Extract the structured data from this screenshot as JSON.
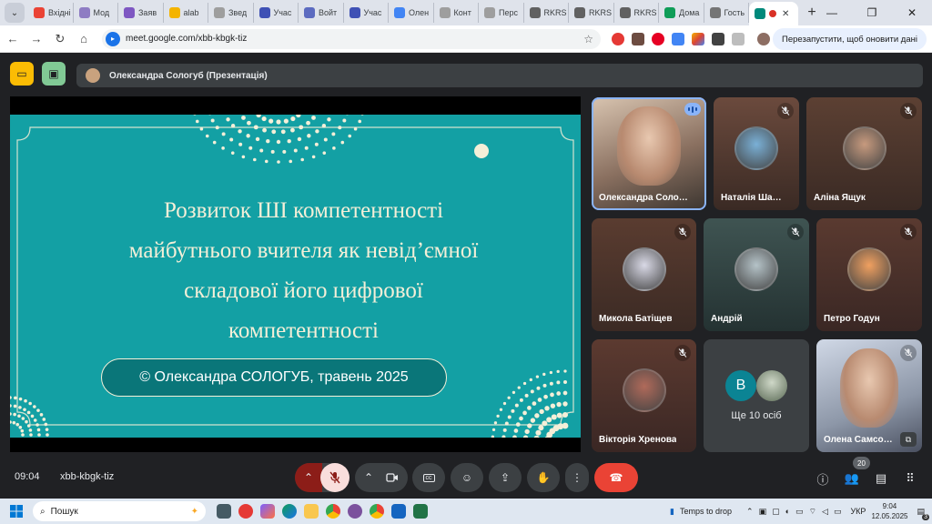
{
  "browser": {
    "tabs": [
      {
        "label": "Вхідні",
        "color": "#ea4335"
      },
      {
        "label": "Мод",
        "color": "#8e7cc3"
      },
      {
        "label": "Заяв",
        "color": "#7e57c2"
      },
      {
        "label": "alab",
        "color": "#f4b400"
      },
      {
        "label": "Звед",
        "color": "#9e9e9e"
      },
      {
        "label": "Учас",
        "color": "#3f51b5"
      },
      {
        "label": "Войт",
        "color": "#5c6bc0"
      },
      {
        "label": "Учас",
        "color": "#3f51b5"
      },
      {
        "label": "Олен",
        "color": "#4285f4"
      },
      {
        "label": "Конт",
        "color": "#9e9e9e"
      },
      {
        "label": "Перс",
        "color": "#9e9e9e"
      },
      {
        "label": "RKRS",
        "color": "#616161"
      },
      {
        "label": "RKRS",
        "color": "#616161"
      },
      {
        "label": "RKRS",
        "color": "#616161"
      },
      {
        "label": "Дома",
        "color": "#0f9d58"
      },
      {
        "label": "Гость",
        "color": "#757575"
      }
    ],
    "active_tab_close": "✕",
    "new_tab": "+",
    "url": "meet.google.com/xbb-kbgk-tiz",
    "relaunch_label": "Перезапустити, щоб оновити дані"
  },
  "meet": {
    "presenter_label": "Олександра Сологуб (Презентація)",
    "slide": {
      "title_lines": [
        "Розвиток ШІ компетентності",
        "майбутнього вчителя  як невід’ємної",
        "складової його цифрової",
        "компетентності"
      ],
      "pill_text": "© Олександра СОЛОГУБ, травень 2025",
      "bg_color": "#13a0a4",
      "text_color": "#f4efd8"
    },
    "participants": [
      {
        "name": "Олександра Соло…",
        "speaking": true
      },
      {
        "name": "Наталія Ша…",
        "muted": true
      },
      {
        "name": "Аліна Ящук",
        "muted": true
      },
      {
        "name": "Микола Батіщев",
        "muted": true
      },
      {
        "name": "Андрій",
        "muted": true
      },
      {
        "name": "Петро Годун",
        "muted": true
      },
      {
        "name": "Вікторія Хренова",
        "muted": true
      },
      {
        "name": "Олена Самсо…",
        "muted": true
      }
    ],
    "others_tile": {
      "initial": "В",
      "label": "Ще 10 осіб"
    },
    "time": "09:04",
    "meeting_code": "xbb-kbgk-tiz",
    "participants_count": "20"
  },
  "taskbar": {
    "search_placeholder": "Пошук",
    "weather": "Temps to drop",
    "lang": "УКР",
    "time": "9:04",
    "date": "12.05.2025",
    "notif_count": "3"
  },
  "colors": {
    "meet_bg": "#202124",
    "end_call": "#ea4335",
    "mic_off": "#f9dedc"
  }
}
